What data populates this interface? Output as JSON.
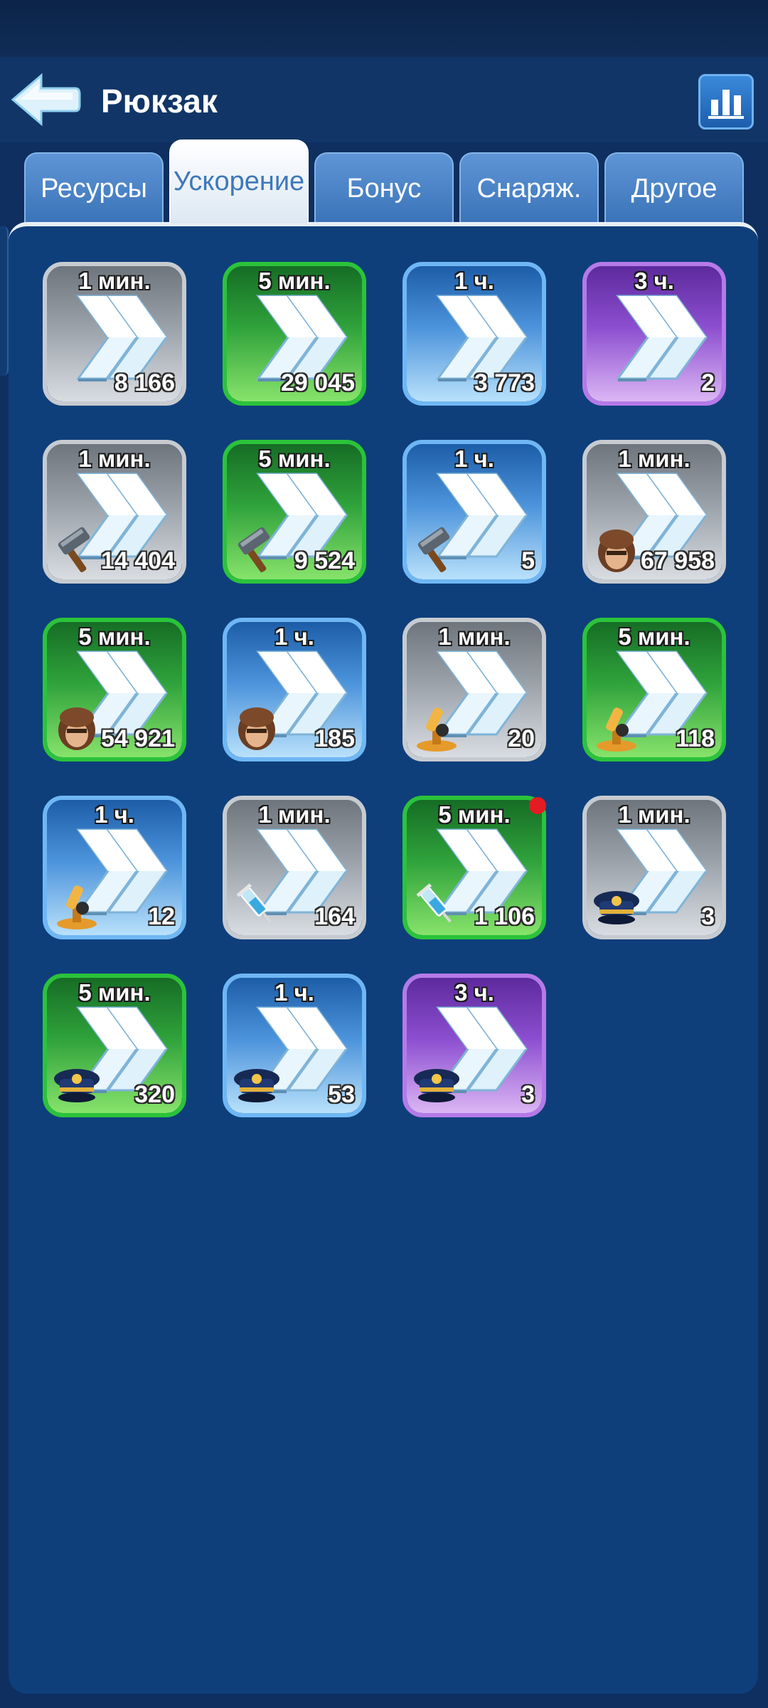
{
  "header": {
    "title": "Рюкзак"
  },
  "tabs": [
    {
      "label": "Ресурсы",
      "active": false
    },
    {
      "label": "Ускорение",
      "active": true
    },
    {
      "label": "Бонус",
      "active": false
    },
    {
      "label": "Снаряж.",
      "active": false
    },
    {
      "label": "Другое",
      "active": false
    }
  ],
  "colors": {
    "background": "#0e2f60",
    "panel": "#0e3f7b",
    "rarity_grey": "#c7cbd0",
    "rarity_green": "#2bc33a",
    "rarity_blue": "#6fb7f4",
    "rarity_purple": "#b57ae8",
    "notification": "#e41b22"
  },
  "items": [
    {
      "duration": "1 мин.",
      "count": "8 166",
      "rarity": "grey",
      "icon": "none"
    },
    {
      "duration": "5 мин.",
      "count": "29 045",
      "rarity": "green",
      "icon": "none"
    },
    {
      "duration": "1 ч.",
      "count": "3 773",
      "rarity": "blue",
      "icon": "none"
    },
    {
      "duration": "3 ч.",
      "count": "2",
      "rarity": "purple",
      "icon": "none"
    },
    {
      "duration": "1 мин.",
      "count": "14 404",
      "rarity": "grey",
      "icon": "hammer-icon"
    },
    {
      "duration": "5 мин.",
      "count": "9 524",
      "rarity": "green",
      "icon": "hammer-icon"
    },
    {
      "duration": "1 ч.",
      "count": "5",
      "rarity": "blue",
      "icon": "hammer-icon"
    },
    {
      "duration": "1 мин.",
      "count": "67 958",
      "rarity": "grey",
      "icon": "soldier-helmet-icon"
    },
    {
      "duration": "5 мин.",
      "count": "54 921",
      "rarity": "green",
      "icon": "soldier-helmet-icon"
    },
    {
      "duration": "1 ч.",
      "count": "185",
      "rarity": "blue",
      "icon": "soldier-helmet-icon"
    },
    {
      "duration": "1 мин.",
      "count": "20",
      "rarity": "grey",
      "icon": "microscope-icon"
    },
    {
      "duration": "5 мин.",
      "count": "118",
      "rarity": "green",
      "icon": "microscope-icon"
    },
    {
      "duration": "1 ч.",
      "count": "12",
      "rarity": "blue",
      "icon": "microscope-icon"
    },
    {
      "duration": "1 мин.",
      "count": "164",
      "rarity": "grey",
      "icon": "syringe-icon"
    },
    {
      "duration": "5 мин.",
      "count": "1 106",
      "rarity": "green",
      "icon": "syringe-icon",
      "notification": true
    },
    {
      "duration": "1 мин.",
      "count": "3",
      "rarity": "grey",
      "icon": "officer-cap-icon"
    },
    {
      "duration": "5 мин.",
      "count": "320",
      "rarity": "green",
      "icon": "officer-cap-icon"
    },
    {
      "duration": "1 ч.",
      "count": "53",
      "rarity": "blue",
      "icon": "officer-cap-icon"
    },
    {
      "duration": "3 ч.",
      "count": "3",
      "rarity": "purple",
      "icon": "officer-cap-icon"
    }
  ]
}
